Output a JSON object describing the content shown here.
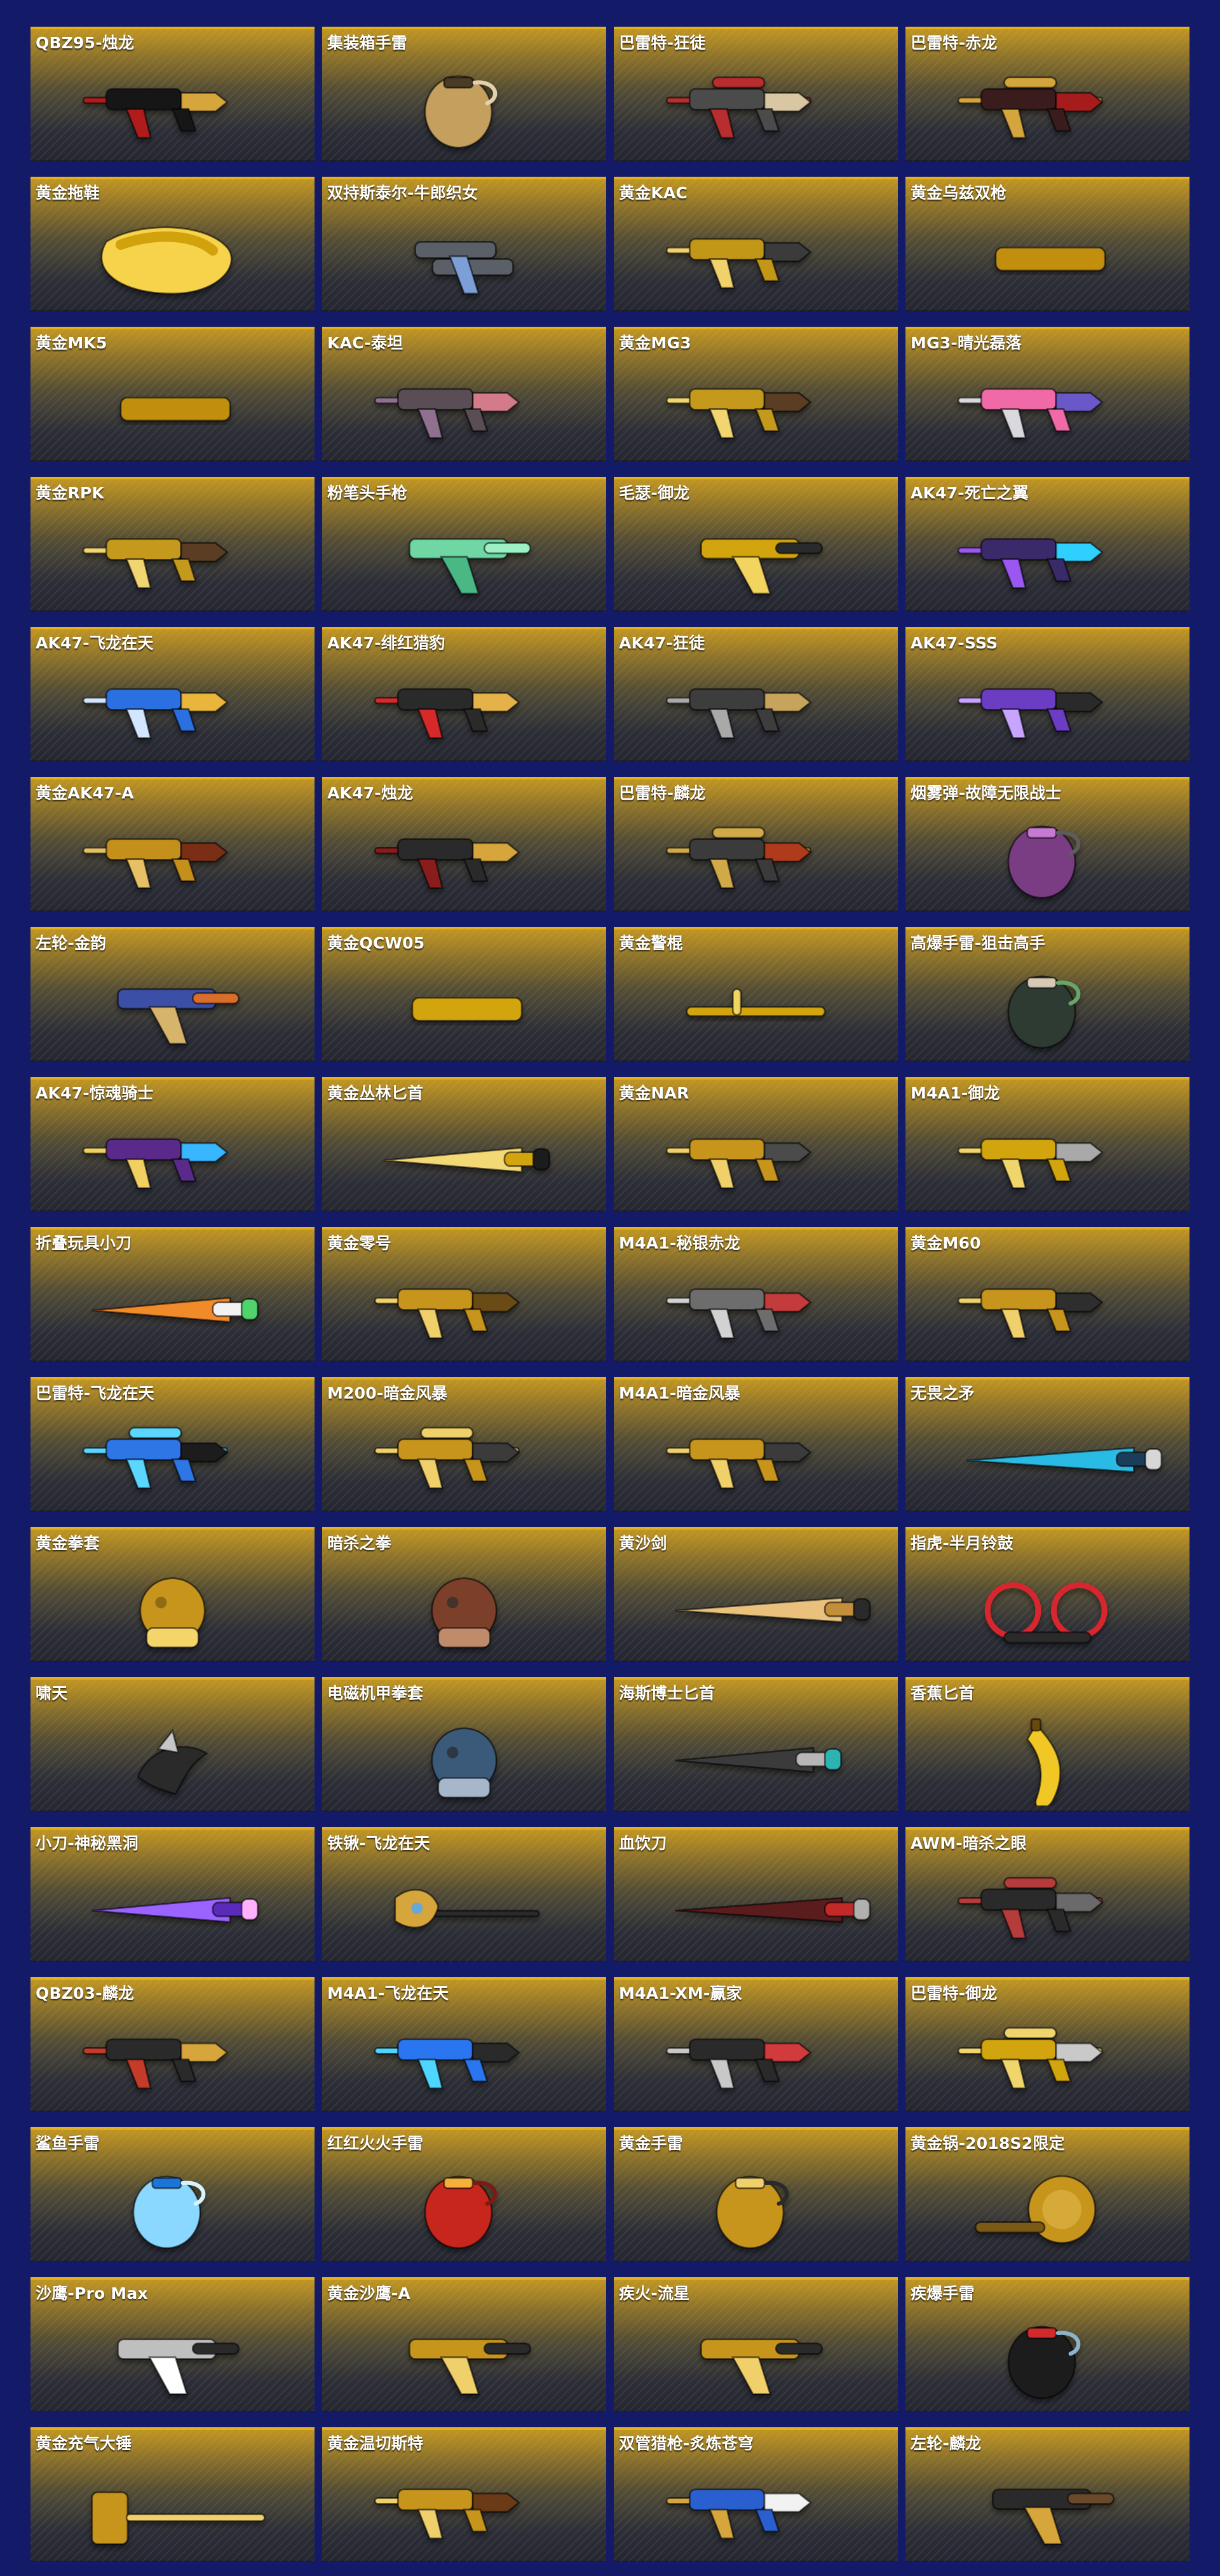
{
  "page": {
    "background": "#131a68",
    "card_accent": "#e3b21a"
  },
  "items": [
    {
      "label": "QBZ95-烛龙",
      "icon": "rifle-icon",
      "colors": [
        "#181818",
        "#b01e1e",
        "#d6a53a"
      ]
    },
    {
      "label": "集装箱手雷",
      "icon": "grenade-icon",
      "colors": [
        "#c59f5d",
        "#4a3a27",
        "#e4d0aa"
      ]
    },
    {
      "label": "巴雷特-狂徒",
      "icon": "sniper-rifle-icon",
      "colors": [
        "#4b4b4b",
        "#b82d2d",
        "#d8c7a2"
      ]
    },
    {
      "label": "巴雷特-赤龙",
      "icon": "sniper-rifle-icon",
      "colors": [
        "#3a1f1a",
        "#d4a53d",
        "#a61f1f"
      ]
    },
    {
      "label": "黄金拖鞋",
      "icon": "slipper-icon",
      "colors": [
        "#d2a20d",
        "#f7d34b",
        "#b45c0f"
      ]
    },
    {
      "label": "双持斯泰尔-牛郎织女",
      "icon": "dual-smg-icon",
      "colors": [
        "#5a5f67",
        "#7b9fd8",
        "#c95b8e"
      ]
    },
    {
      "label": "黄金KAC",
      "icon": "rifle-icon",
      "colors": [
        "#c29616",
        "#f1d16c",
        "#3b3b3b"
      ]
    },
    {
      "label": "黄金乌兹双枪",
      "icon": "smg-icon",
      "colors": [
        "#c18f11",
        "#efd164",
        "#3a3a3a"
      ]
    },
    {
      "label": "黄金MK5",
      "icon": "smg-icon",
      "colors": [
        "#c18f11",
        "#efd164",
        "#2e2e2e"
      ]
    },
    {
      "label": "KAC-泰坦",
      "icon": "rifle-icon",
      "colors": [
        "#5a4d57",
        "#8f6f8f",
        "#d37a8b"
      ]
    },
    {
      "label": "黄金MG3",
      "icon": "machine-gun-icon",
      "colors": [
        "#c59a1f",
        "#f0d570",
        "#5a3e20"
      ]
    },
    {
      "label": "MG3-晴光磊落",
      "icon": "machine-gun-icon",
      "colors": [
        "#f06aa8",
        "#d8d8dd",
        "#6b58c8"
      ]
    },
    {
      "label": "黄金RPK",
      "icon": "machine-gun-icon",
      "colors": [
        "#c59a1f",
        "#f0d570",
        "#5a3e20"
      ]
    },
    {
      "label": "粉笔头手枪",
      "icon": "chalk-pistol-icon",
      "colors": [
        "#6fd7a4",
        "#4ab885",
        "#9bf0c4"
      ]
    },
    {
      "label": "毛瑟-御龙",
      "icon": "pistol-icon",
      "colors": [
        "#d2a40f",
        "#f2d461",
        "#2a2a2a"
      ]
    },
    {
      "label": "AK47-死亡之翼",
      "icon": "rifle-icon",
      "colors": [
        "#3b2a6b",
        "#9a58f1",
        "#2fd0ff"
      ]
    },
    {
      "label": "AK47-飞龙在天",
      "icon": "rifle-icon",
      "colors": [
        "#2c6fe0",
        "#d2e7ff",
        "#e9b63a"
      ]
    },
    {
      "label": "AK47-绯红猎豹",
      "icon": "rifle-icon",
      "colors": [
        "#2a2a2a",
        "#d62c2c",
        "#e5b24a"
      ]
    },
    {
      "label": "AK47-狂徒",
      "icon": "rifle-icon",
      "colors": [
        "#3c3c3c",
        "#a9a9a9",
        "#c8a35b"
      ]
    },
    {
      "label": "AK47-SSS",
      "icon": "rifle-icon",
      "colors": [
        "#6a3dc2",
        "#c7a5ff",
        "#2a2a2a"
      ]
    },
    {
      "label": "黄金AK47-A",
      "icon": "rifle-icon",
      "colors": [
        "#c58f1d",
        "#e7c065",
        "#7a2e16"
      ]
    },
    {
      "label": "AK47-烛龙",
      "icon": "rifle-icon",
      "colors": [
        "#2a2a2a",
        "#8b1f1f",
        "#d6a53a"
      ]
    },
    {
      "label": "巴雷特-麟龙",
      "icon": "sniper-rifle-icon",
      "colors": [
        "#3a3a3a",
        "#d0a94a",
        "#b03b1d"
      ]
    },
    {
      "label": "烟雾弹-故障无限战士",
      "icon": "robot-grenade-icon",
      "colors": [
        "#7a3c84",
        "#c67ad2",
        "#5c5c5c"
      ]
    },
    {
      "label": "左轮-金韵",
      "icon": "revolver-icon",
      "colors": [
        "#3b4fa6",
        "#d6b46c",
        "#d96e2a"
      ]
    },
    {
      "label": "黄金QCW05",
      "icon": "smg-icon",
      "colors": [
        "#d2a40f",
        "#f2d461",
        "#2a2a2a"
      ]
    },
    {
      "label": "黄金警棍",
      "icon": "baton-icon",
      "colors": [
        "#d2a40f",
        "#f2d461",
        "#8a6a10"
      ]
    },
    {
      "label": "高爆手雷-狙击高手",
      "icon": "grenade-icon",
      "colors": [
        "#2f3b33",
        "#d7c9b6",
        "#67a56a"
      ]
    },
    {
      "label": "AK47-惊魂骑士",
      "icon": "rifle-icon",
      "colors": [
        "#5a2b8a",
        "#f0d060",
        "#39b6ff"
      ]
    },
    {
      "label": "黄金丛林匕首",
      "icon": "knife-icon",
      "colors": [
        "#d2a40f",
        "#f3d876",
        "#1a1a1a"
      ]
    },
    {
      "label": "黄金NAR",
      "icon": "rifle-icon",
      "colors": [
        "#c7941d",
        "#f0d06a",
        "#4b4b4b"
      ]
    },
    {
      "label": "M4A1-御龙",
      "icon": "rifle-icon",
      "colors": [
        "#d2a40f",
        "#f0d56d",
        "#a9a9a9"
      ]
    },
    {
      "label": "折叠玩具小刀",
      "icon": "knife-icon",
      "colors": [
        "#f2f2f2",
        "#f18b2a",
        "#4fd36b"
      ]
    },
    {
      "label": "黄金零号",
      "icon": "shotgun-icon",
      "colors": [
        "#c7941d",
        "#f0d06a",
        "#6a4b12"
      ]
    },
    {
      "label": "M4A1-秘银赤龙",
      "icon": "rifle-icon",
      "colors": [
        "#6d6d6d",
        "#d2d2d2",
        "#c33b3b"
      ]
    },
    {
      "label": "黄金M60",
      "icon": "machine-gun-icon",
      "colors": [
        "#c7941d",
        "#f0d06a",
        "#2f2f2f"
      ]
    },
    {
      "label": "巴雷特-飞龙在天",
      "icon": "sniper-rifle-icon",
      "colors": [
        "#2d74e6",
        "#5ad6ff",
        "#1a1a1a"
      ]
    },
    {
      "label": "M200-暗金风暴",
      "icon": "sniper-rifle-icon",
      "colors": [
        "#c7941d",
        "#f0d06a",
        "#3b3b3b"
      ]
    },
    {
      "label": "M4A1-暗金风暴",
      "icon": "rifle-icon",
      "colors": [
        "#c7941d",
        "#f0d06a",
        "#3b3b3b"
      ]
    },
    {
      "label": "无畏之矛",
      "icon": "spear-icon",
      "colors": [
        "#1d3c5a",
        "#2bbbe4",
        "#d7d7d7"
      ]
    },
    {
      "label": "黄金拳套",
      "icon": "boxing-glove-icon",
      "colors": [
        "#c7941d",
        "#f3d56a",
        "#7a5a12"
      ]
    },
    {
      "label": "暗杀之拳",
      "icon": "gauntlet-icon",
      "colors": [
        "#7b3f2a",
        "#c08b6a",
        "#2e2e2e"
      ]
    },
    {
      "label": "黄沙剑",
      "icon": "sword-icon",
      "colors": [
        "#c48f3a",
        "#e9c07b",
        "#2a2a2a"
      ]
    },
    {
      "label": "指虎-半月铃鼓",
      "icon": "knuckles-icon",
      "colors": [
        "#d8262d",
        "#ffffff",
        "#2a2a2a"
      ]
    },
    {
      "label": "啸天",
      "icon": "claw-icon",
      "colors": [
        "#2a2a2a",
        "#c6c6c6",
        "#8a8a8a"
      ]
    },
    {
      "label": "电磁机甲拳套",
      "icon": "mech-glove-icon",
      "colors": [
        "#3a5a7a",
        "#a6b7cc",
        "#2a2a2a"
      ]
    },
    {
      "label": "海斯博士匕首",
      "icon": "knife-icon",
      "colors": [
        "#b7b7b7",
        "#3b3b3b",
        "#2db4b0"
      ]
    },
    {
      "label": "香蕉匕首",
      "icon": "banana-icon",
      "colors": [
        "#f1c726",
        "#fff19a",
        "#6b4a10"
      ]
    },
    {
      "label": "小刀-神秘黑洞",
      "icon": "knife-icon",
      "colors": [
        "#5a2bb8",
        "#9b63ff",
        "#ffb0ff"
      ]
    },
    {
      "label": "铁锹-飞龙在天",
      "icon": "shovel-icon",
      "colors": [
        "#d6a53a",
        "#4fa8ff",
        "#2a2a2a"
      ]
    },
    {
      "label": "血饮刀",
      "icon": "blade-icon",
      "colors": [
        "#c22a2a",
        "#5a1b1b",
        "#b0b0b0"
      ]
    },
    {
      "label": "AWM-暗杀之眼",
      "icon": "sniper-rifle-icon",
      "colors": [
        "#2a2a2a",
        "#b63a3a",
        "#6b6b6b"
      ]
    },
    {
      "label": "QBZ03-麟龙",
      "icon": "rifle-icon",
      "colors": [
        "#2a2a2a",
        "#c43a2a",
        "#d6a53a"
      ]
    },
    {
      "label": "M4A1-飞龙在天",
      "icon": "rifle-icon",
      "colors": [
        "#2a76f0",
        "#4fd6ff",
        "#2a2a2a"
      ]
    },
    {
      "label": "M4A1-XM-赢家",
      "icon": "rifle-icon",
      "colors": [
        "#2a2a2a",
        "#c8c8c8",
        "#d23a3a"
      ]
    },
    {
      "label": "巴雷特-御龙",
      "icon": "sniper-rifle-icon",
      "colors": [
        "#d2a40f",
        "#f0d56d",
        "#c9c9c9"
      ]
    },
    {
      "label": "鲨鱼手雷",
      "icon": "fishbowl-grenade-icon",
      "colors": [
        "#8ad8ff",
        "#1e73d8",
        "#d6f4ff"
      ]
    },
    {
      "label": "红红火火手雷",
      "icon": "fire-grenade-icon",
      "colors": [
        "#c7261e",
        "#f3b13a",
        "#7a1a13"
      ]
    },
    {
      "label": "黄金手雷",
      "icon": "grenade-icon",
      "colors": [
        "#c7941d",
        "#f0d06a",
        "#2a2a2a"
      ]
    },
    {
      "label": "黄金锅-2018S2限定",
      "icon": "frying-pan-icon",
      "colors": [
        "#c7941d",
        "#f3d56a",
        "#7a5a12"
      ]
    },
    {
      "label": "沙鹰-Pro Max",
      "icon": "pistol-icon",
      "colors": [
        "#bfbfbf",
        "#ffffff",
        "#2a2a2a"
      ]
    },
    {
      "label": "黄金沙鹰-A",
      "icon": "pistol-icon",
      "colors": [
        "#c7941d",
        "#f0d06a",
        "#2a2a2a"
      ]
    },
    {
      "label": "疾火-流星",
      "icon": "dual-pistol-icon",
      "colors": [
        "#c7941d",
        "#f0d06a",
        "#2a2a2a"
      ]
    },
    {
      "label": "疾爆手雷",
      "icon": "canister-grenade-icon",
      "colors": [
        "#1a1a1a",
        "#d22c2c",
        "#8fb2cc"
      ]
    },
    {
      "label": "黄金充气大锤",
      "icon": "hammer-icon",
      "colors": [
        "#c7941d",
        "#f0d06a",
        "#7a5a12"
      ]
    },
    {
      "label": "黄金温切斯特",
      "icon": "shotgun-icon",
      "colors": [
        "#c7941d",
        "#f0d06a",
        "#6a3a18"
      ]
    },
    {
      "label": "双管猎枪-炙炼苍穹",
      "icon": "shotgun-icon",
      "colors": [
        "#2a5fcf",
        "#d6a53a",
        "#f2f2f2"
      ]
    },
    {
      "label": "左轮-麟龙",
      "icon": "revolver-icon",
      "colors": [
        "#2a2a2a",
        "#d6a53a",
        "#6b4a2a"
      ]
    }
  ]
}
